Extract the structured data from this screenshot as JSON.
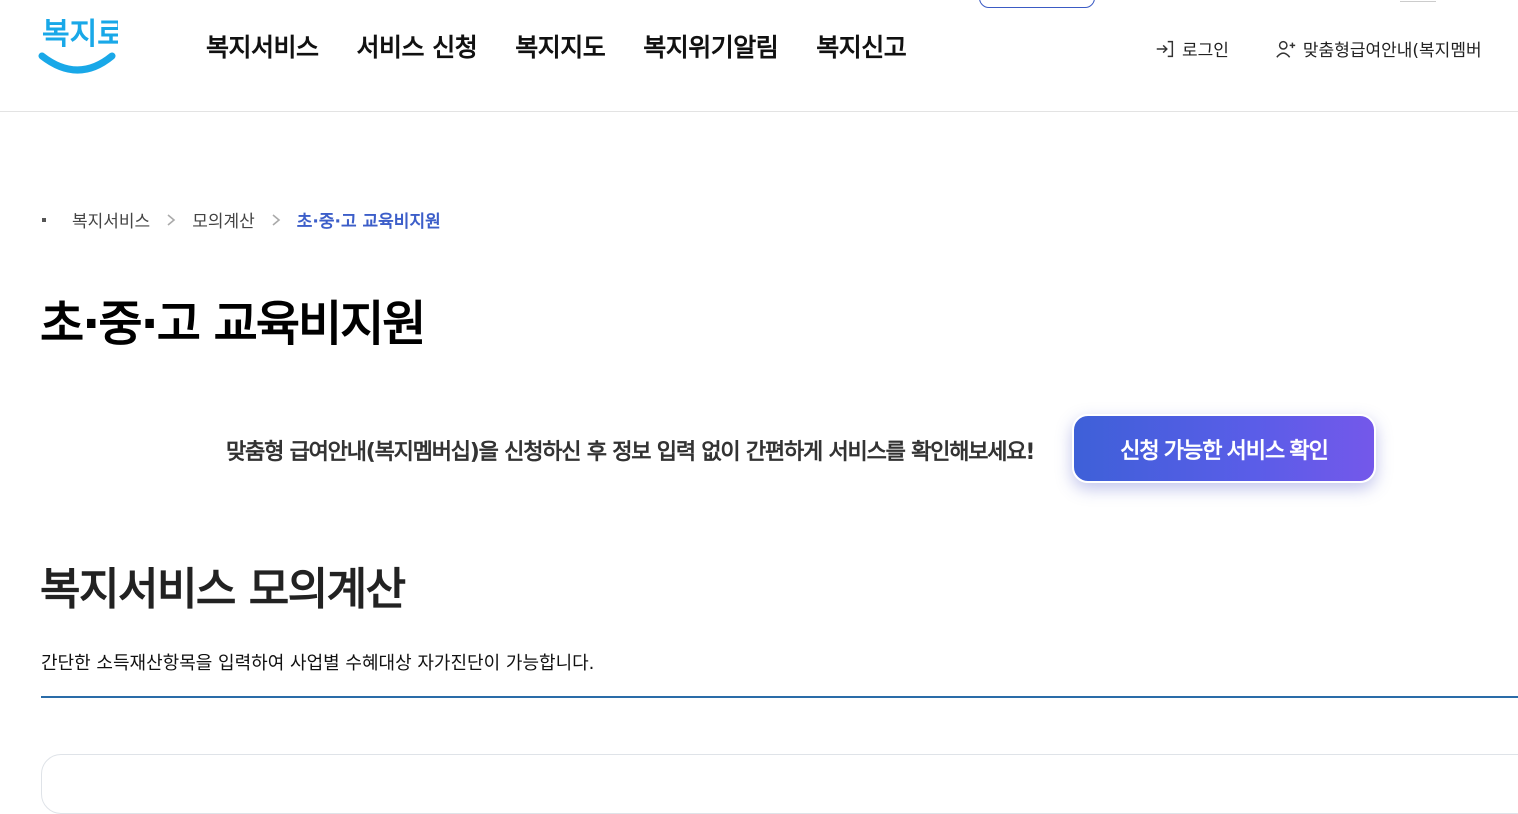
{
  "header": {
    "logo_text": "복지로",
    "gnb": [
      "복지서비스",
      "서비스 신청",
      "복지지도",
      "복지위기알림",
      "복지신고"
    ],
    "util": {
      "login": "로그인",
      "membership": "맞춤형급여안내(복지멤버"
    }
  },
  "breadcrumb": [
    "복지서비스",
    "모의계산",
    "초·중·고 교육비지원"
  ],
  "page": {
    "title": "초·중·고 교육비지원",
    "promo_text": "맞춤형 급여안내(복지멤버십)을 신청하신 후 정보 입력 없이 간편하게 서비스를 확인해보세요!",
    "promo_button": "신청 가능한 서비스 확인"
  },
  "section": {
    "title": "복지서비스 모의계산",
    "desc": "간단한 소득재산항목을 입력하여 사업별 수혜대상 자가진단이 가능합니다."
  },
  "colors": {
    "brand_blue": "#3c5ec9",
    "logo_blue": "#19a8e8",
    "button_gradient_start": "#3e60d8",
    "button_gradient_end": "#7458ea",
    "rule": "#2a6ca8"
  },
  "icons": {
    "login": "login-icon",
    "membership": "user-plus-icon"
  }
}
